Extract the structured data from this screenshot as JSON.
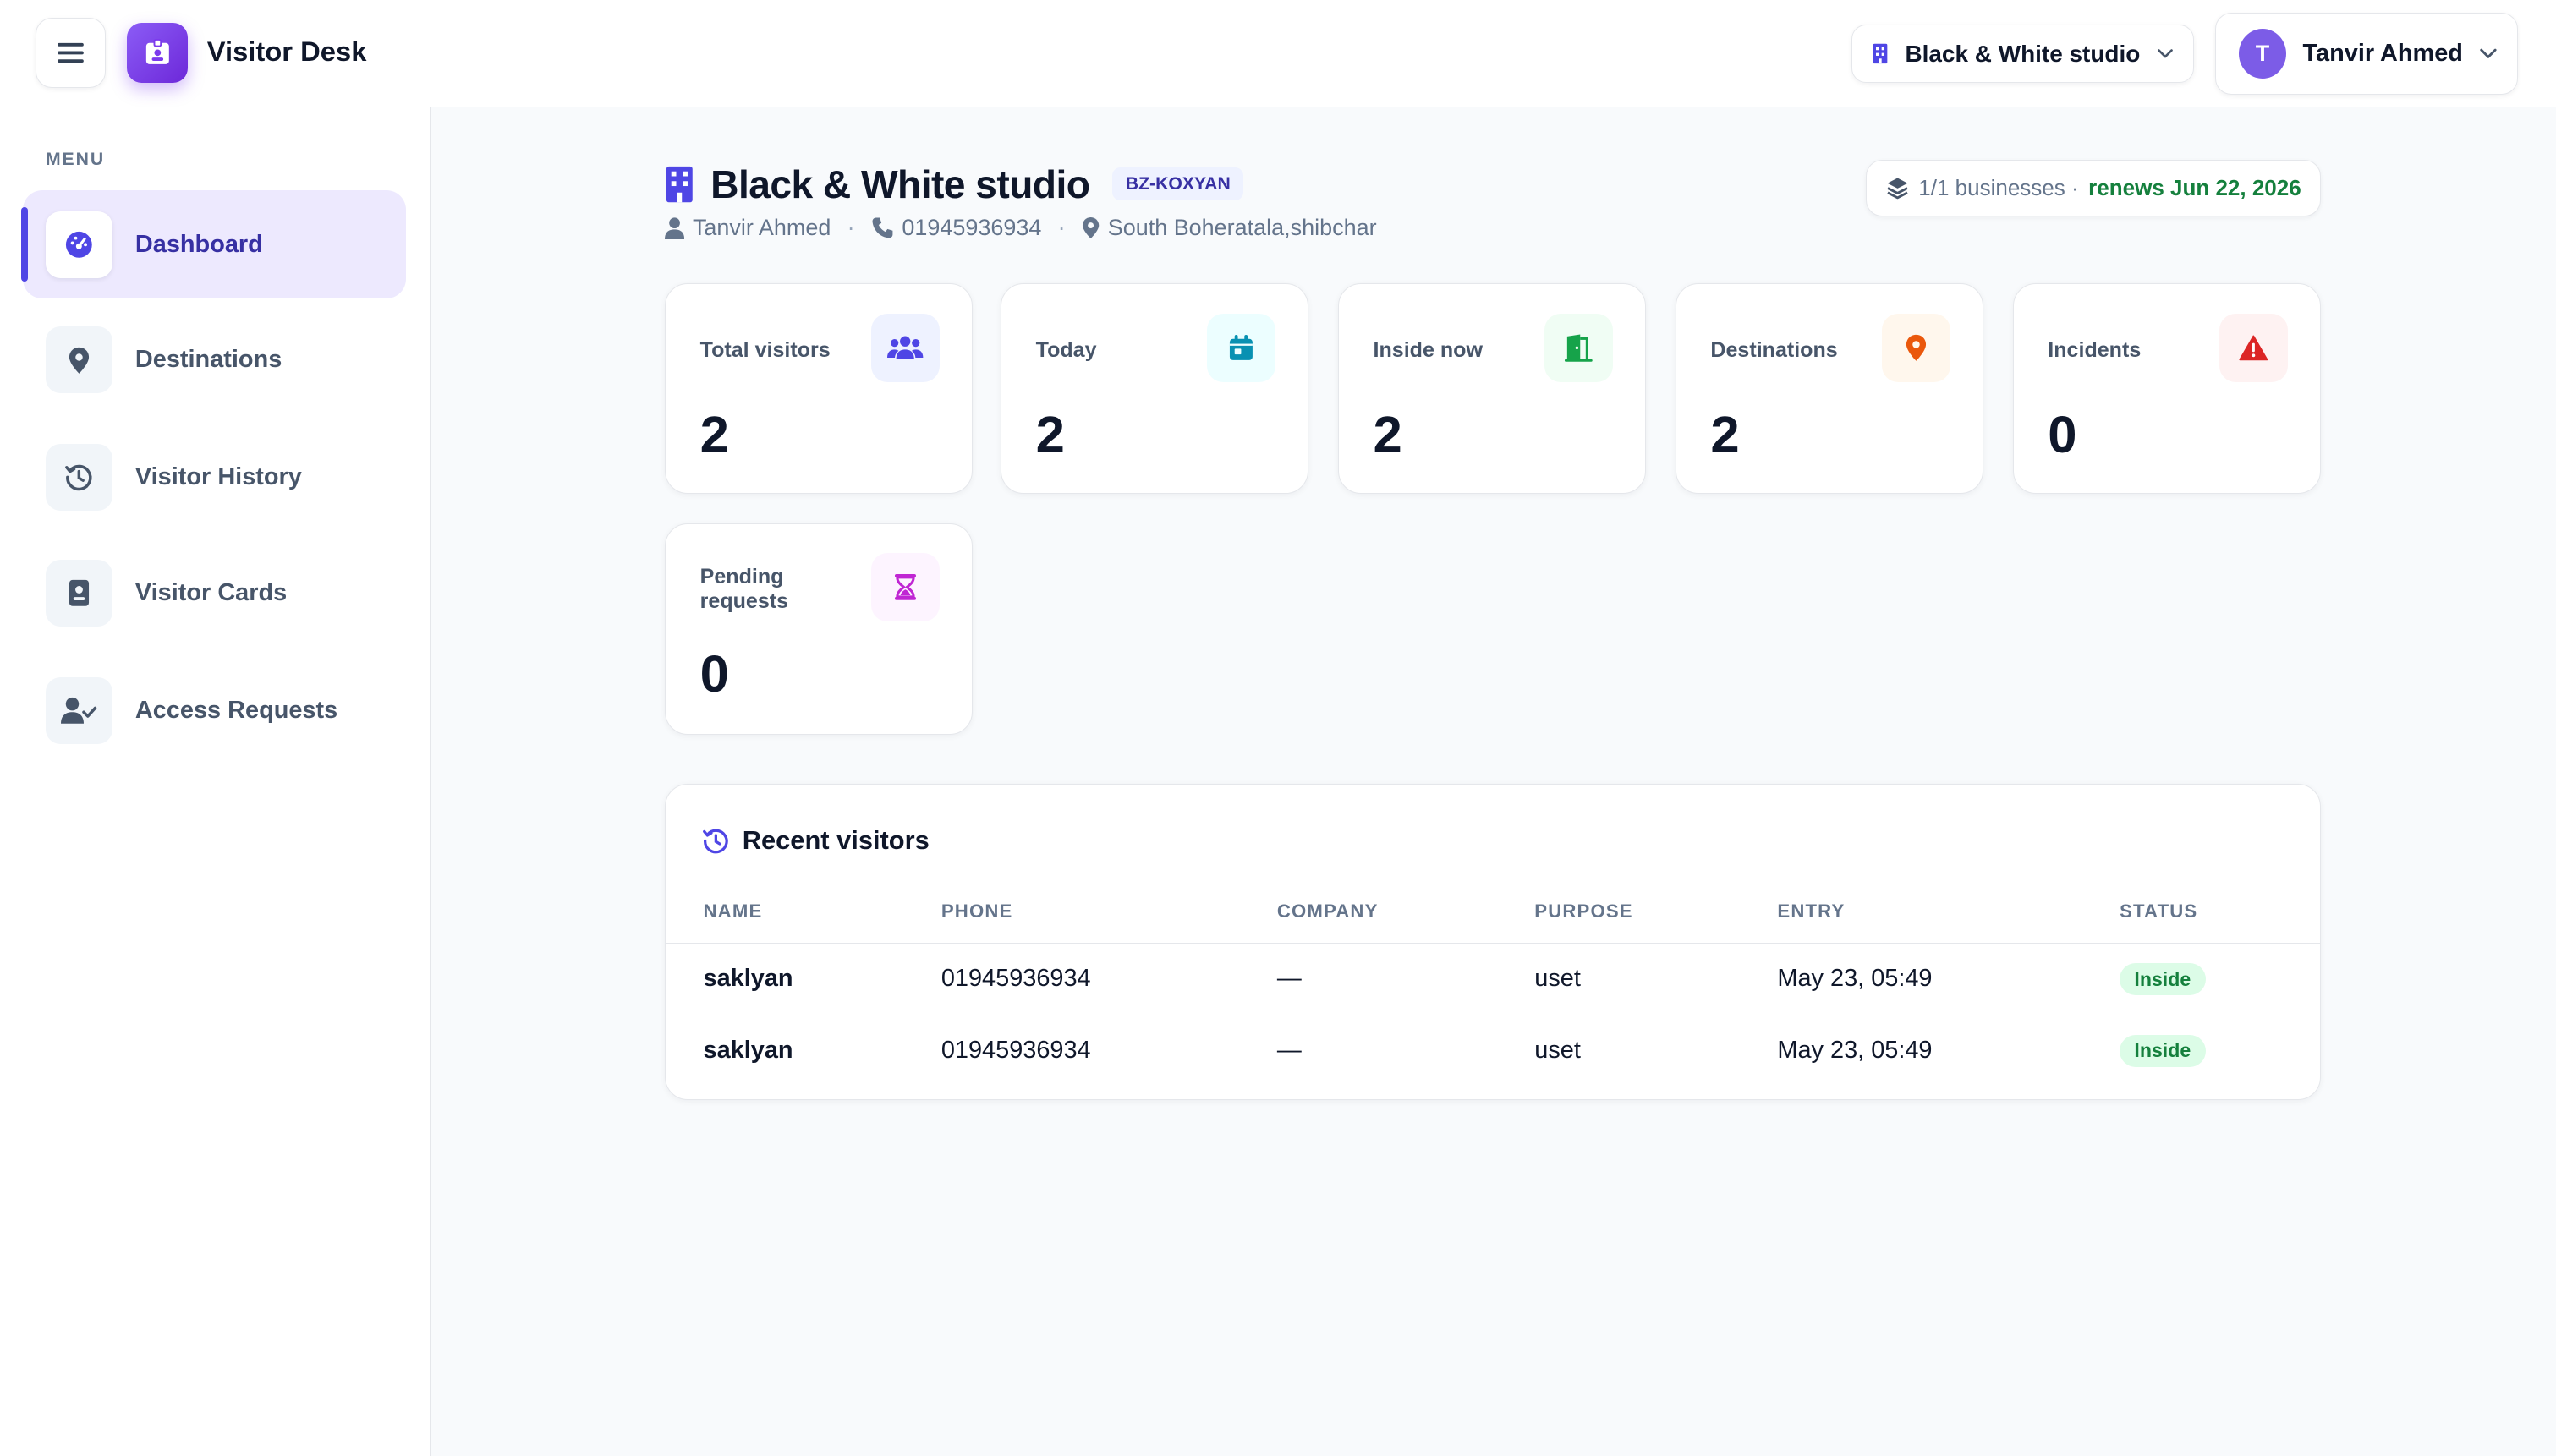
{
  "header": {
    "app_title": "Visitor Desk",
    "business_select": "Black & White studio",
    "user_initial": "T",
    "user_name": "Tanvir Ahmed"
  },
  "sidebar": {
    "menu_label": "MENU",
    "items": [
      {
        "label": "Dashboard",
        "icon": "gauge-icon",
        "active": true
      },
      {
        "label": "Destinations",
        "icon": "map-pin-icon",
        "active": false
      },
      {
        "label": "Visitor History",
        "icon": "history-icon",
        "active": false
      },
      {
        "label": "Visitor Cards",
        "icon": "id-card-icon",
        "active": false
      },
      {
        "label": "Access Requests",
        "icon": "user-check-icon",
        "active": false
      }
    ]
  },
  "business": {
    "name": "Black & White studio",
    "code": "BZ-KOXYAN",
    "owner": "Tanvir Ahmed",
    "phone": "01945936934",
    "address": "South Boheratala,shibchar",
    "plan_usage": "1/1 businesses ·",
    "plan_renews": "renews Jun 22, 2026"
  },
  "stats": [
    {
      "label": "Total visitors",
      "value": "2",
      "icon": "users-icon",
      "color": "#4f46e5",
      "bg": "#eef2ff"
    },
    {
      "label": "Today",
      "value": "2",
      "icon": "calendar-icon",
      "color": "#0891b2",
      "bg": "#ecfeff"
    },
    {
      "label": "Inside now",
      "value": "2",
      "icon": "door-open-icon",
      "color": "#16a34a",
      "bg": "#f0fdf4"
    },
    {
      "label": "Destinations",
      "value": "2",
      "icon": "map-pin-icon",
      "color": "#ea580c",
      "bg": "#fff7ed"
    },
    {
      "label": "Incidents",
      "value": "0",
      "icon": "warning-icon",
      "color": "#dc2626",
      "bg": "#fef2f2"
    },
    {
      "label": "Pending requests",
      "value": "0",
      "icon": "hourglass-icon",
      "color": "#c026d3",
      "bg": "#fdf4ff"
    }
  ],
  "recent": {
    "title": "Recent visitors",
    "columns": [
      "NAME",
      "PHONE",
      "COMPANY",
      "PURPOSE",
      "ENTRY",
      "STATUS"
    ],
    "rows": [
      {
        "name": "saklyan",
        "phone": "01945936934",
        "company": "—",
        "purpose": "uset",
        "entry": "May 23, 05:49",
        "status": "Inside"
      },
      {
        "name": "saklyan",
        "phone": "01945936934",
        "company": "—",
        "purpose": "uset",
        "entry": "May 23, 05:49",
        "status": "Inside"
      }
    ]
  }
}
